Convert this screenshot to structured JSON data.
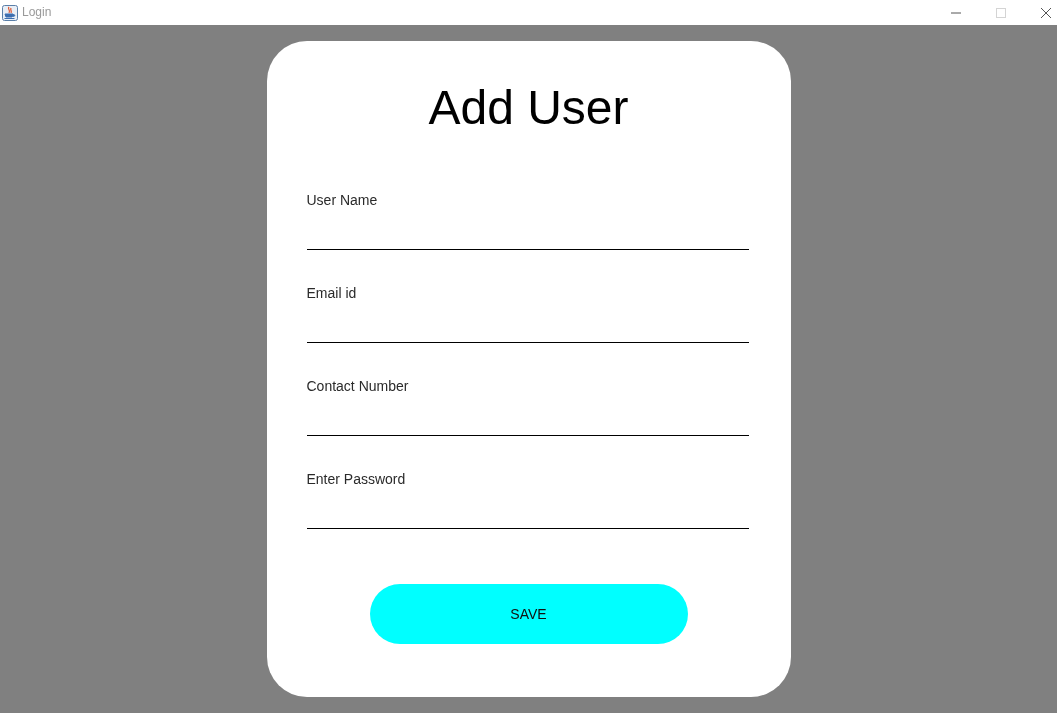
{
  "window": {
    "title": "Login",
    "controls": [
      {
        "kind": "minimize",
        "disabled": false
      },
      {
        "kind": "maximize",
        "disabled": true
      },
      {
        "kind": "close",
        "disabled": false
      }
    ]
  },
  "form": {
    "title": "Add User",
    "fields": [
      {
        "label": "User Name"
      },
      {
        "label": "Email id"
      },
      {
        "label": "Contact Number"
      },
      {
        "label": "Enter Password"
      }
    ],
    "button": "SAVE"
  }
}
